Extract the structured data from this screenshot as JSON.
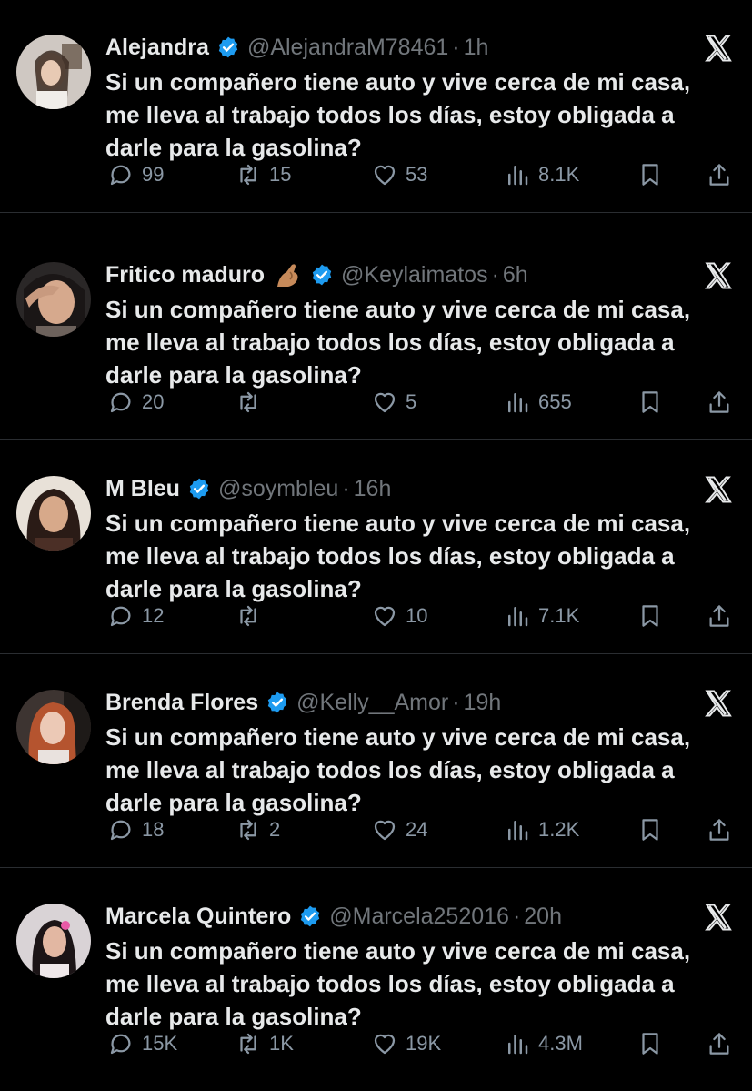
{
  "colors": {
    "verified": "#1d9bf0",
    "muted": "#71767b",
    "text": "#e7e9ea",
    "background": "#000000"
  },
  "tweet_text": [
    "Si un compañero tiene auto y vive cerca de mi casa,",
    "me lleva al trabajo todos los días, estoy obligada a",
    "darle para la gasolina?"
  ],
  "tweets": [
    {
      "name": "Alejandra",
      "handle": "@AlejandraM78461",
      "time": "1h",
      "replies": "99",
      "retweets": "15",
      "likes": "53",
      "views": "8.1K"
    },
    {
      "name": "Fritico maduro",
      "handle": "@Keylaimatos",
      "time": "6h",
      "replies": "20",
      "retweets": "",
      "likes": "5",
      "views": "655"
    },
    {
      "name": "M Bleu",
      "handle": "@soymbleu",
      "time": "16h",
      "replies": "12",
      "retweets": "",
      "likes": "10",
      "views": "7.1K"
    },
    {
      "name": "Brenda Flores",
      "handle": "@Kelly__Amor",
      "time": "19h",
      "replies": "18",
      "retweets": "2",
      "likes": "24",
      "views": "1.2K"
    },
    {
      "name": "Marcela Quintero",
      "handle": "@Marcela252016",
      "time": "20h",
      "replies": "15K",
      "retweets": "1K",
      "likes": "19K",
      "views": "4.3M"
    }
  ],
  "separator": "·",
  "icons": [
    "verified-badge-icon",
    "x-logo-icon",
    "reply-icon",
    "retweet-icon",
    "like-icon",
    "views-icon",
    "bookmark-icon",
    "share-icon",
    "pinched-fingers-emoji-icon"
  ]
}
